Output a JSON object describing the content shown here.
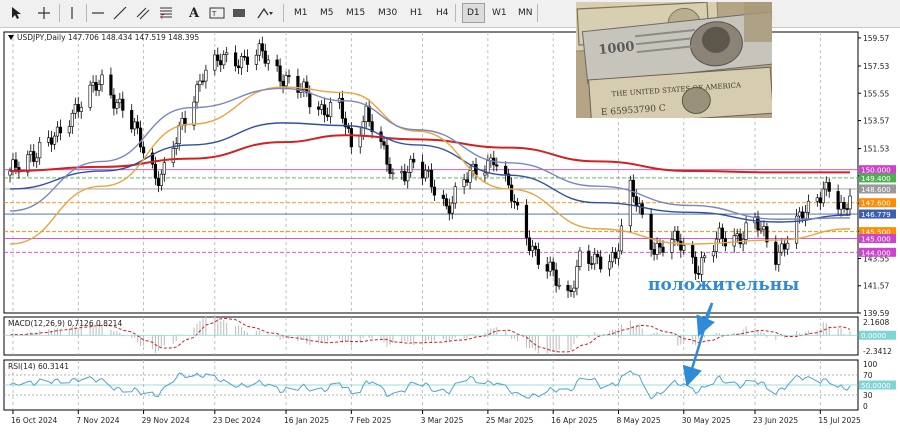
{
  "toolbar": {
    "icons": [
      "cursor-icon",
      "crosshair-icon",
      "vertical-line-icon",
      "horizontal-line-icon",
      "trendline-icon",
      "channel-icon",
      "fibonacci-icon",
      "text-icon",
      "label-icon",
      "rectangle-icon",
      "shapes-icon"
    ],
    "timeframes": [
      "M1",
      "M5",
      "M15",
      "M30",
      "H1",
      "H4",
      "D1",
      "W1",
      "MN"
    ],
    "active_timeframe": "D1"
  },
  "chart_data": [
    {
      "type": "candlestick",
      "title": "USDJPY,Daily  147.706 148.434 147.519 148.395",
      "symbol": "USDJPY",
      "timeframe": "Daily",
      "last_bar": {
        "open": 147.706,
        "high": 148.434,
        "low": 147.519,
        "close": 148.395
      },
      "ylim": [
        139.59,
        160.0
      ],
      "y_ticks": [
        159.57,
        157.53,
        155.55,
        153.57,
        151.53,
        149.55,
        147.57,
        145.53,
        143.55,
        141.57,
        139.59
      ],
      "x_ticks": [
        "16 Oct 2024",
        "7 Nov 2024",
        "29 Nov 2024",
        "23 Dec 2024",
        "16 Jan 2025",
        "7 Feb 2025",
        "3 Mar 2025",
        "25 Mar 2025",
        "16 Apr 2025",
        "8 May 2025",
        "30 May 2025",
        "23 Jun 2025",
        "15 Jul 2025"
      ],
      "x_range": [
        "2024-10-15",
        "2025-07-25"
      ],
      "price_levels": [
        {
          "value": "150.000",
          "color": "#cc44cc"
        },
        {
          "value": "149.400",
          "color": "#4caf50"
        },
        {
          "value": "148.600",
          "color": "#999999"
        },
        {
          "value": "147.600",
          "color": "#ff8c00"
        },
        {
          "value": "146.779",
          "color": "#3a5fb0"
        },
        {
          "value": "145.500",
          "color": "#ff8c00"
        },
        {
          "value": "145.000",
          "color": "#cc44cc"
        },
        {
          "value": "144.000",
          "color": "#cc44cc"
        }
      ],
      "anchors": [
        [
          "2024-10-15",
          149.6
        ],
        [
          "2024-10-22",
          151.2
        ],
        [
          "2024-10-31",
          152.3
        ],
        [
          "2024-11-06",
          154.6
        ],
        [
          "2024-11-15",
          156.3
        ],
        [
          "2024-11-22",
          154.6
        ],
        [
          "2024-12-03",
          149.6
        ],
        [
          "2024-12-06",
          150.0
        ],
        [
          "2024-12-13",
          153.6
        ],
        [
          "2024-12-19",
          157.2
        ],
        [
          "2024-12-27",
          158.0
        ],
        [
          "2025-01-08",
          158.3
        ],
        [
          "2025-01-10",
          157.8
        ],
        [
          "2025-01-20",
          155.9
        ],
        [
          "2025-01-27",
          154.5
        ],
        [
          "2025-02-03",
          154.6
        ],
        [
          "2025-02-07",
          151.5
        ],
        [
          "2025-02-12",
          154.4
        ],
        [
          "2025-02-21",
          149.3
        ],
        [
          "2025-02-28",
          150.6
        ],
        [
          "2025-03-11",
          147.4
        ],
        [
          "2025-03-18",
          149.3
        ],
        [
          "2025-03-27",
          151.0
        ],
        [
          "2025-04-04",
          146.9
        ],
        [
          "2025-04-11",
          143.5
        ],
        [
          "2025-04-21",
          140.9
        ],
        [
          "2025-04-25",
          143.6
        ],
        [
          "2025-04-30",
          143.1
        ],
        [
          "2025-05-07",
          143.9
        ],
        [
          "2025-05-12",
          148.5
        ],
        [
          "2025-05-20",
          144.4
        ],
        [
          "2025-05-28",
          144.7
        ],
        [
          "2025-06-04",
          143.0
        ],
        [
          "2025-06-11",
          144.9
        ],
        [
          "2025-06-18",
          145.3
        ],
        [
          "2025-06-23",
          146.1
        ],
        [
          "2025-06-30",
          143.9
        ],
        [
          "2025-07-03",
          144.7
        ],
        [
          "2025-07-09",
          146.6
        ],
        [
          "2025-07-16",
          148.8
        ],
        [
          "2025-07-18",
          148.6
        ],
        [
          "2025-07-23",
          146.5
        ],
        [
          "2025-07-25",
          148.4
        ]
      ],
      "moving_averages": [
        {
          "color": "#d42020",
          "points": [
            [
              "2024-10-15",
              149.9
            ],
            [
              "2024-11-15",
              150.2
            ],
            [
              "2024-12-15",
              150.8
            ],
            [
              "2025-01-15",
              152.0
            ],
            [
              "2025-02-05",
              152.5
            ],
            [
              "2025-03-01",
              152.2
            ],
            [
              "2025-04-01",
              151.6
            ],
            [
              "2025-05-01",
              150.6
            ],
            [
              "2025-06-01",
              149.9
            ],
            [
              "2025-07-01",
              149.8
            ],
            [
              "2025-07-25",
              149.8
            ]
          ]
        },
        {
          "color": "#2e4fa3",
          "points": [
            [
              "2024-10-15",
              148.6
            ],
            [
              "2024-11-15",
              149.9
            ],
            [
              "2024-12-15",
              151.8
            ],
            [
              "2025-01-15",
              153.4
            ],
            [
              "2025-02-05",
              153.2
            ],
            [
              "2025-03-01",
              151.8
            ],
            [
              "2025-04-01",
              149.6
            ],
            [
              "2025-05-01",
              147.6
            ],
            [
              "2025-06-01",
              146.9
            ],
            [
              "2025-07-01",
              146.2
            ],
            [
              "2025-07-25",
              146.7
            ]
          ]
        },
        {
          "color": "#e8a640",
          "points": [
            [
              "2024-10-15",
              144.6
            ],
            [
              "2024-11-15",
              148.8
            ],
            [
              "2024-12-15",
              153.3
            ],
            [
              "2025-01-15",
              156.0
            ],
            [
              "2025-02-05",
              155.6
            ],
            [
              "2025-03-01",
              152.8
            ],
            [
              "2025-04-01",
              148.6
            ],
            [
              "2025-05-01",
              145.7
            ],
            [
              "2025-06-01",
              144.6
            ],
            [
              "2025-07-01",
              144.9
            ],
            [
              "2025-07-25",
              145.7
            ]
          ]
        },
        {
          "color": "#7a86c0",
          "points": [
            [
              "2024-10-15",
              147.0
            ],
            [
              "2024-11-15",
              150.6
            ],
            [
              "2024-12-15",
              154.5
            ],
            [
              "2025-01-15",
              155.9
            ],
            [
              "2025-02-05",
              155.0
            ],
            [
              "2025-03-01",
              152.9
            ],
            [
              "2025-04-01",
              150.5
            ],
            [
              "2025-05-01",
              148.8
            ],
            [
              "2025-06-01",
              147.4
            ],
            [
              "2025-07-01",
              146.4
            ],
            [
              "2025-07-25",
              146.5
            ]
          ]
        }
      ]
    },
    {
      "type": "bar",
      "title": "MACD(12,26,9)  0.7126  0.8214",
      "y_ticks": [
        "2.1608",
        "0.0000",
        "-2.3412"
      ],
      "ylim": [
        -2.3412,
        2.1608
      ],
      "signal_color": "#cc2020",
      "histogram_color": "#c0c0c0"
    },
    {
      "type": "line",
      "title": "RSI(14)  60.3141",
      "y_ticks": [
        "100",
        "70",
        "50.0000",
        "30",
        "0"
      ],
      "ylim": [
        0,
        100
      ],
      "line_color": "#4aa8c8"
    }
  ],
  "annotation": {
    "text": "положительны",
    "color": "#2e8bd8"
  }
}
